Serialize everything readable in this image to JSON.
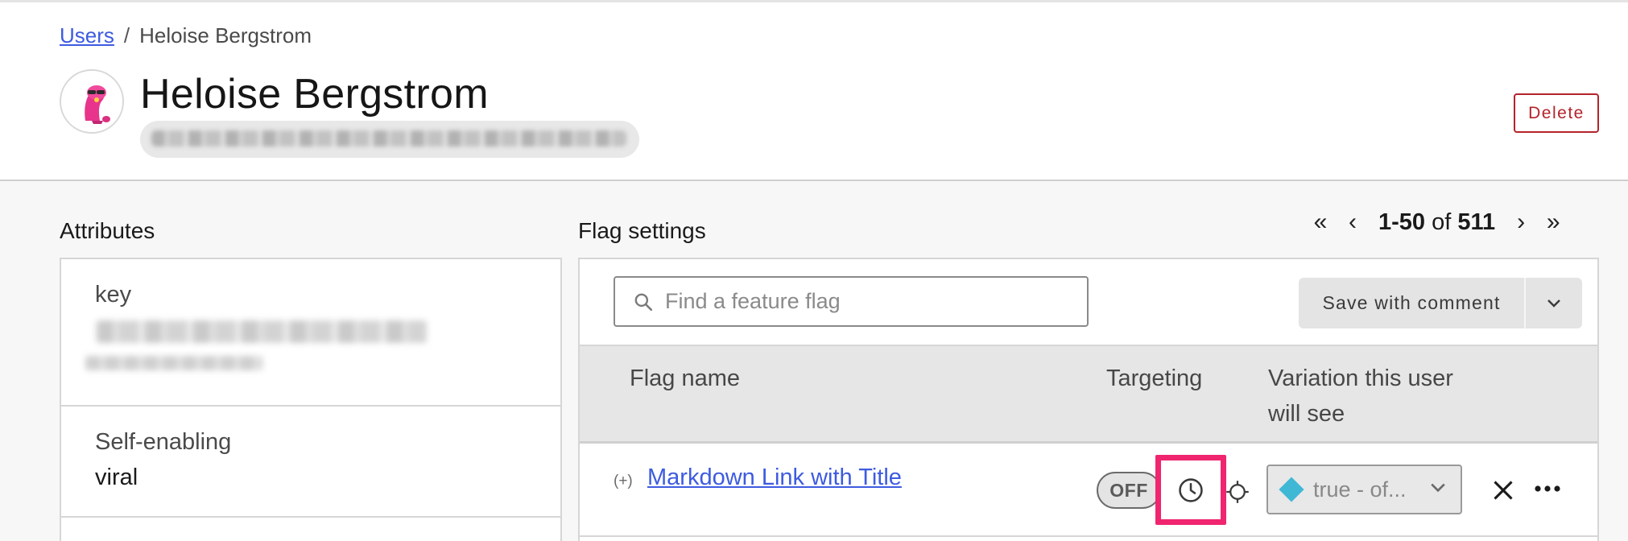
{
  "breadcrumb": {
    "parent": "Users",
    "separator": "/",
    "current": "Heloise Bergstrom"
  },
  "user": {
    "name": "Heloise Bergstrom",
    "key_blurred": ""
  },
  "header": {
    "delete_label": "Delete"
  },
  "attributes": {
    "title": "Attributes",
    "items": [
      {
        "label": "key",
        "value": ""
      },
      {
        "label": "Self-enabling",
        "value": "viral"
      }
    ]
  },
  "flags": {
    "title": "Flag settings",
    "search_placeholder": "Find a feature flag",
    "save_label": "Save with comment",
    "columns": {
      "name": "Flag name",
      "targeting": "Targeting",
      "variation_line1": "Variation this user",
      "variation_line2": "will see"
    },
    "rows": [
      {
        "expand": "(+)",
        "name": "Markdown Link with Title",
        "toggle": "OFF",
        "variation": "true - of..."
      }
    ]
  },
  "pagination": {
    "first": "«",
    "prev": "‹",
    "range": "1-50",
    "of": "of",
    "total": "511",
    "next": "›",
    "last": "»"
  },
  "colors": {
    "link": "#3d5be0",
    "danger": "#b4232a",
    "highlight": "#f0256f",
    "variation_diamond": "#3fb8d6"
  },
  "icons": [
    "search-icon",
    "chevron-down-icon",
    "clock-icon",
    "target-icon",
    "close-icon",
    "more-icon"
  ]
}
